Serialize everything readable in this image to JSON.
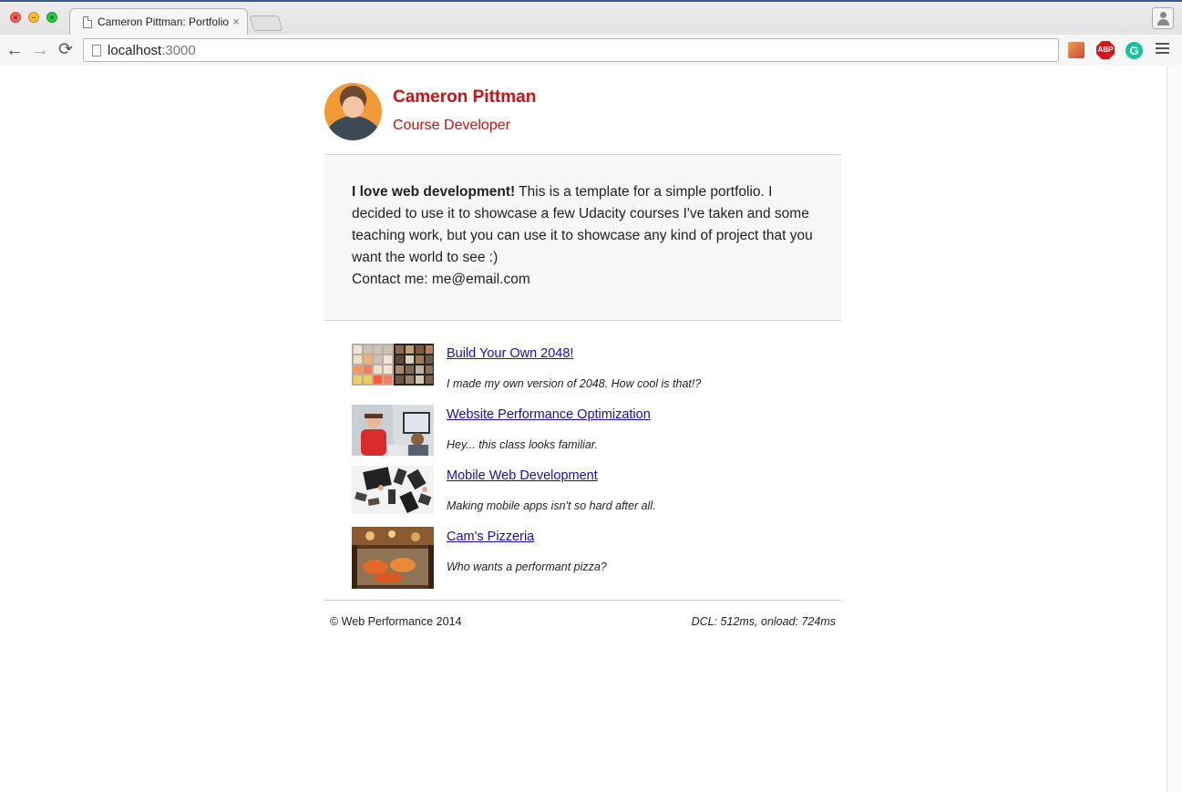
{
  "browser": {
    "tab_title": "Cameron Pittman: Portfolio",
    "tab_close": "×",
    "url_host": "localhost",
    "url_port": ":3000",
    "extensions": {
      "abp_label": "ABP",
      "grammarly_label": "G"
    },
    "icons": {
      "back": "←",
      "forward": "→",
      "reload": "⟳"
    }
  },
  "header": {
    "name": "Cameron Pittman",
    "role": "Course Developer"
  },
  "intro": {
    "bold": "I love web development!",
    "text": " This is a template for a simple portfolio. I decided to use it to showcase a few Udacity courses I've taken and some teaching work, but you can use it to showcase any kind of project that you want the world to see :)",
    "contact": "Contact me: me@email.com"
  },
  "projects": [
    {
      "title": "Build Your Own 2048!",
      "description": "I made my own version of 2048. How cool is that!?"
    },
    {
      "title": "Website Performance Optimization",
      "description": "Hey... this class looks familiar."
    },
    {
      "title": "Mobile Web Development",
      "description": "Making mobile apps isn't so hard after all."
    },
    {
      "title": "Cam's Pizzeria",
      "description": "Who wants a performant pizza?"
    }
  ],
  "footer": {
    "copyright": "© Web Performance 2014",
    "perf": "DCL: 512ms, onload: 724ms"
  },
  "colors": {
    "accent": "#cc1111",
    "link": "#1a0dab",
    "intro_bg": "#f7f7f7"
  }
}
